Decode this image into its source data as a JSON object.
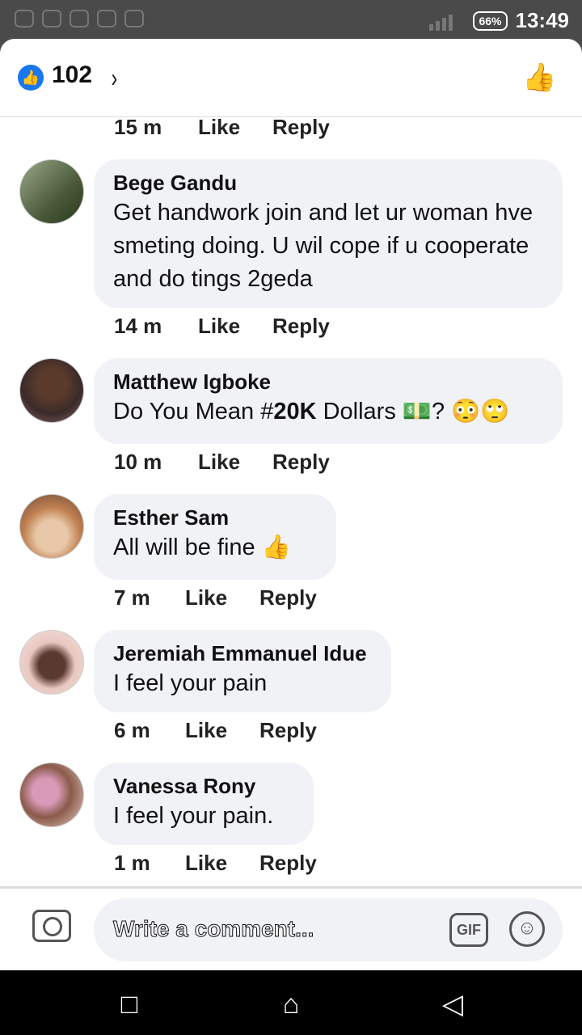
{
  "status_bar": {
    "time": "13:49",
    "battery": "66%",
    "app_icons": [
      "instagram-icon",
      "twitter-icon",
      "warning-icon",
      "image-icon",
      "instagram-icon"
    ]
  },
  "header": {
    "like_count": "102",
    "chevron": "›",
    "like_glyph": "👍"
  },
  "comments": [
    {
      "time": "15 m",
      "like": "Like",
      "reply": "Reply"
    },
    {
      "name": "Bege Gandu",
      "text": "Get handwork join and let ur woman hve smeting doing. U wil cope if u cooperate and do tings 2geda",
      "time": "14 m",
      "like": "Like",
      "reply": "Reply"
    },
    {
      "name": "Matthew Igboke",
      "text_pre": "Do You Mean #",
      "text_bold": "20K",
      "text_post": " Dollars 💵? 😳🙄",
      "time": "10 m",
      "like": "Like",
      "reply": "Reply"
    },
    {
      "name": "Esther Sam",
      "text": "All will be fine 👍",
      "time": "7 m",
      "like": "Like",
      "reply": "Reply"
    },
    {
      "name": "Jeremiah Emmanuel Idue",
      "text": "I feel your pain",
      "time": "6 m",
      "like": "Like",
      "reply": "Reply"
    },
    {
      "name": "Vanessa Rony",
      "text": "I feel your pain.",
      "time": "1 m",
      "like": "Like",
      "reply": "Reply"
    }
  ],
  "composer": {
    "placeholder": "Write a comment...",
    "gif": "GIF",
    "emoji": "☺"
  },
  "nav": {
    "back": "◁",
    "home": "⌂",
    "recents": "□"
  },
  "colors": {
    "like_blue": "#1877f2",
    "bubble_bg": "#f0f2f5"
  }
}
